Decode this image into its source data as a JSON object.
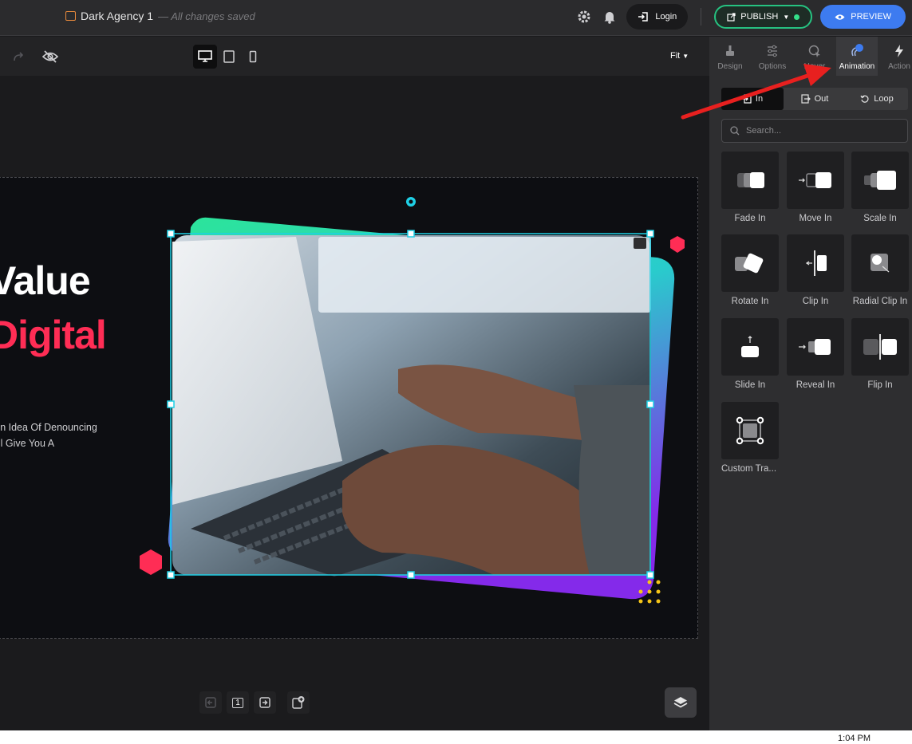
{
  "header": {
    "doc_title": "Dark Agency 1",
    "saved_status": "— All changes saved",
    "login_label": "Login",
    "publish_label": "PUBLISH",
    "preview_label": "PREVIEW"
  },
  "toolbar": {
    "zoom_label": "Fit"
  },
  "panel": {
    "tabs": [
      {
        "label": "Design",
        "icon": "brush-icon"
      },
      {
        "label": "Options",
        "icon": "sliders-icon"
      },
      {
        "label": "Hover",
        "icon": "cursor-icon"
      },
      {
        "label": "Animation",
        "icon": "animation-icon"
      },
      {
        "label": "Action",
        "icon": "bolt-icon"
      }
    ],
    "active_tab": "Animation",
    "segments": [
      {
        "label": "In"
      },
      {
        "label": "Out"
      },
      {
        "label": "Loop"
      }
    ],
    "search_placeholder": "Search...",
    "animations": [
      {
        "label": "Fade In"
      },
      {
        "label": "Move In"
      },
      {
        "label": "Scale In"
      },
      {
        "label": "Rotate In"
      },
      {
        "label": "Clip In"
      },
      {
        "label": "Radial Clip In"
      },
      {
        "label": "Slide In"
      },
      {
        "label": "Reveal In"
      },
      {
        "label": "Flip In"
      },
      {
        "label": "Custom Tra..."
      }
    ]
  },
  "canvas": {
    "headline_line1": "Value",
    "headline_line2": "Digital",
    "paragraph_line1": "ken Idea Of Denouncing",
    "paragraph_line2": "Vill Give You A",
    "page_number": "1"
  },
  "taskbar": {
    "time": "1:04 PM"
  },
  "colors": {
    "accent_blue": "#3d7bf0",
    "publish_green": "#26c281",
    "headline_red": "#ff2d55",
    "selection_cyan": "#1fd0e6",
    "arrow_red": "#e8201f"
  }
}
